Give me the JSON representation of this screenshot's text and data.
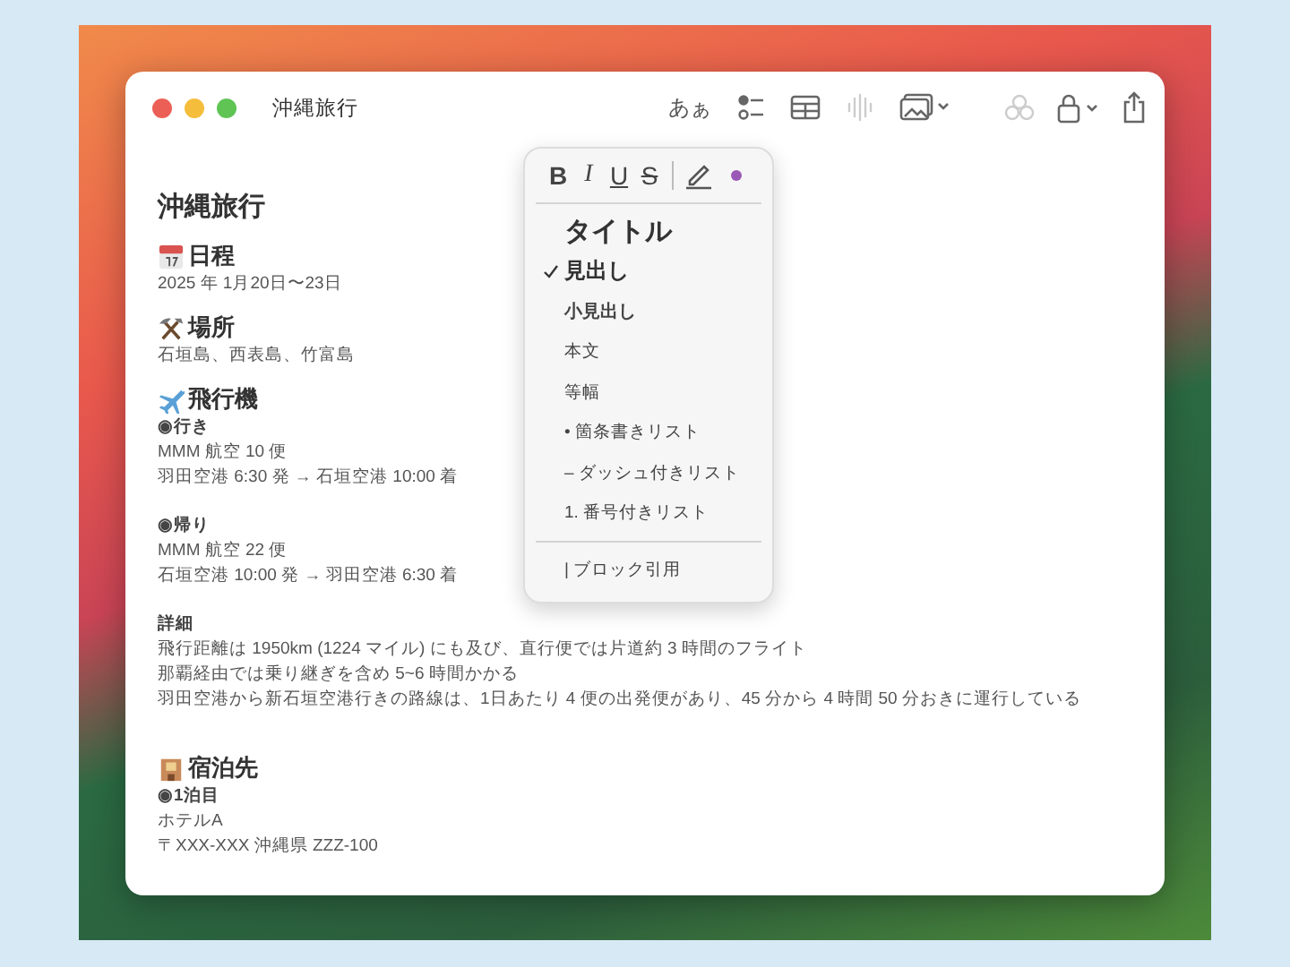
{
  "window": {
    "title": "沖縄旅行"
  },
  "toolbar": [
    {
      "kind": "text",
      "label": "あぁ",
      "disabled": false
    },
    {
      "kind": "checklist",
      "disabled": false
    },
    {
      "kind": "table",
      "disabled": false
    },
    {
      "kind": "waveform",
      "disabled": true
    },
    {
      "kind": "media",
      "disabled": false
    },
    {
      "kind": "collaborate",
      "disabled": true
    },
    {
      "kind": "lock",
      "disabled": false
    },
    {
      "kind": "share",
      "disabled": false
    }
  ],
  "format_menu": {
    "styles": [
      {
        "kind": "bold",
        "label": "B"
      },
      {
        "kind": "italic",
        "label": "I"
      },
      {
        "kind": "underline",
        "label": "U"
      },
      {
        "kind": "strike",
        "label": "S"
      }
    ],
    "color": "#9b59b6",
    "items": [
      {
        "kind": "title",
        "label": "タイトル",
        "checked": false
      },
      {
        "kind": "heading",
        "label": "見出し",
        "checked": true
      },
      {
        "kind": "subheading",
        "label": "小見出し",
        "checked": false
      },
      {
        "kind": "body",
        "label": "本文",
        "checked": false
      },
      {
        "kind": "body",
        "label": "等幅",
        "checked": false
      },
      {
        "kind": "body",
        "label": "• 箇条書きリスト",
        "checked": false
      },
      {
        "kind": "body",
        "label": "– ダッシュ付きリスト",
        "checked": false
      },
      {
        "kind": "body",
        "label": "1. 番号付きリスト",
        "checked": false
      },
      {
        "kind": "divider"
      },
      {
        "kind": "body",
        "label": "| ブロック引用",
        "checked": false
      }
    ]
  },
  "note": {
    "title": "沖縄旅行",
    "sections": [
      {
        "heading": "日程",
        "groups": [
          [
            {
              "text": "2025 年 1月20日〜23日",
              "bold": false
            }
          ]
        ]
      },
      {
        "heading": "場所",
        "groups": [
          [
            {
              "text": "石垣島、西表島、竹富島",
              "bold": false
            }
          ]
        ]
      },
      {
        "heading": "飛行機",
        "groups": [
          [
            {
              "text": "◉行き",
              "bold": true
            },
            {
              "text": "MMM 航空 10 便",
              "bold": false
            },
            {
              "text": "羽田空港 6:30 発 → 石垣空港 10:00 着",
              "bold": false
            }
          ],
          [
            {
              "text": "◉帰り",
              "bold": true
            },
            {
              "text": "MMM 航空 22 便",
              "bold": false
            },
            {
              "text": "石垣空港 10:00 発 → 羽田空港 6:30 着",
              "bold": false
            }
          ],
          [
            {
              "text": "詳細",
              "bold": true
            },
            {
              "text": "飛行距離は 1950km (1224 マイル) にも及び、直行便では片道約 3 時間のフライト",
              "bold": false
            },
            {
              "text": "那覇経由では乗り継ぎを含め 5~6 時間かかる",
              "bold": false
            },
            {
              "text": "羽田空港から新石垣空港行きの路線は、1日あたり 4 便の出発便があり、45 分から 4 時間 50 分おきに運行している",
              "bold": false
            }
          ]
        ]
      },
      {
        "heading": "宿泊先",
        "groups": [
          [
            {
              "text": "◉1泊目",
              "bold": true
            },
            {
              "text": "ホテルA",
              "bold": false
            },
            {
              "text": "〒XXX-XXX 沖縄県 ZZZ-100",
              "bold": false
            }
          ]
        ]
      }
    ]
  }
}
